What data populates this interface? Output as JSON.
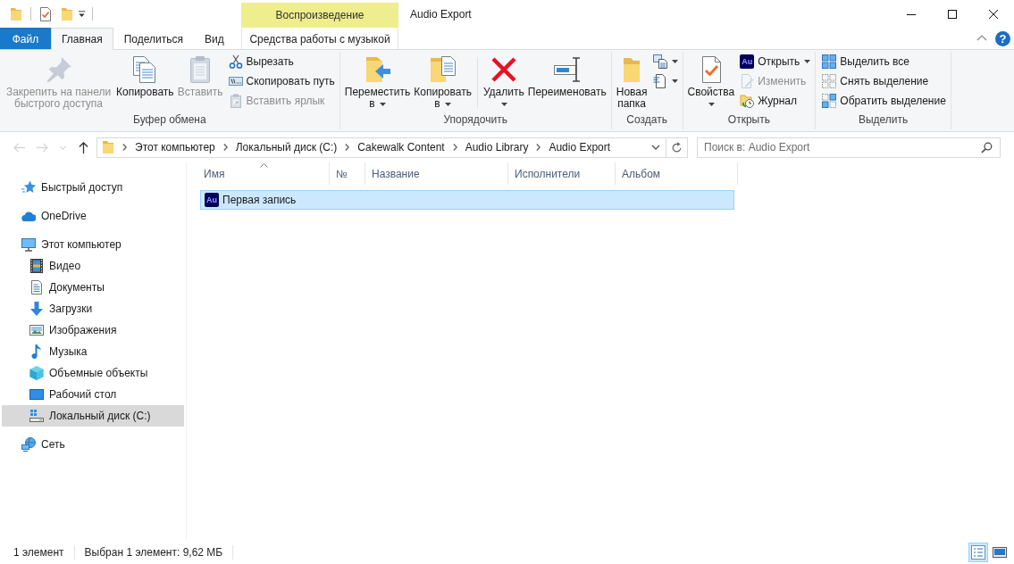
{
  "title_bar": {
    "title": "Audio Export",
    "context_tab_group": "Воспроизведение"
  },
  "ribbon_tabs": [
    {
      "label": "Файл",
      "kind": "file",
      "selected": false
    },
    {
      "label": "Главная",
      "kind": "tab",
      "selected": true
    },
    {
      "label": "Поделиться",
      "kind": "tab",
      "selected": false
    },
    {
      "label": "Вид",
      "kind": "tab",
      "selected": false
    },
    {
      "label": "Средства работы с музыкой",
      "kind": "context",
      "selected": false
    }
  ],
  "ribbon_help": "?",
  "ribbon": {
    "groups": [
      {
        "label": "Буфер обмена",
        "commands": [
          {
            "label": "Закрепить на панели быстрого доступа",
            "kind": "large",
            "disabled": true,
            "has_menu": false
          },
          {
            "label": "Копировать",
            "kind": "large",
            "disabled": false,
            "has_menu": false
          },
          {
            "label": "Вставить",
            "kind": "large",
            "disabled": true,
            "has_menu": false
          },
          {
            "label": "Вырезать",
            "kind": "small",
            "disabled": false,
            "has_menu": false
          },
          {
            "label": "Скопировать путь",
            "kind": "small",
            "disabled": false,
            "has_menu": false
          },
          {
            "label": "Вставить ярлык",
            "kind": "small",
            "disabled": true,
            "has_menu": false
          }
        ]
      },
      {
        "label": "Упорядочить",
        "commands": [
          {
            "label": "Переместить в",
            "kind": "large",
            "disabled": false,
            "has_menu": true
          },
          {
            "label": "Копировать в",
            "kind": "large",
            "disabled": false,
            "has_menu": true
          },
          {
            "label": "Удалить",
            "kind": "large",
            "disabled": false,
            "has_menu": true
          },
          {
            "label": "Переименовать",
            "kind": "large",
            "disabled": false,
            "has_menu": false
          }
        ]
      },
      {
        "label": "Создать",
        "commands": [
          {
            "label": "Новая папка",
            "kind": "large",
            "disabled": false,
            "has_menu": false
          },
          {
            "kind": "icon",
            "disabled": false,
            "has_menu": true
          },
          {
            "kind": "icon",
            "disabled": false,
            "has_menu": true
          }
        ]
      },
      {
        "label": "Открыть",
        "commands": [
          {
            "label": "Свойства",
            "kind": "large",
            "disabled": false,
            "has_menu": true
          },
          {
            "label": "Открыть",
            "kind": "small",
            "icon_text": "Au",
            "disabled": false,
            "has_menu": true
          },
          {
            "label": "Изменить",
            "kind": "small",
            "disabled": true,
            "has_menu": false
          },
          {
            "label": "Журнал",
            "kind": "small",
            "disabled": false,
            "has_menu": false
          }
        ]
      },
      {
        "label": "Выделить",
        "commands": [
          {
            "label": "Выделить все",
            "kind": "small",
            "disabled": false,
            "has_menu": false
          },
          {
            "label": "Снять выделение",
            "kind": "small",
            "disabled": false,
            "has_menu": false
          },
          {
            "label": "Обратить выделение",
            "kind": "small",
            "disabled": false,
            "has_menu": false
          }
        ]
      }
    ]
  },
  "navigation": {
    "buttons": [
      {
        "kind": "back",
        "disabled": true
      },
      {
        "kind": "forward",
        "disabled": true
      },
      {
        "kind": "recent",
        "disabled": true
      },
      {
        "kind": "up",
        "disabled": false
      }
    ]
  },
  "address_bar": {
    "breadcrumbs": [
      "Этот компьютер",
      "Локальный диск (C:)",
      "Cakewalk Content",
      "Audio Library",
      "Audio Export"
    ]
  },
  "search": {
    "placeholder": "Поиск в: Audio Export"
  },
  "sidebar": {
    "items": [
      {
        "label": "Быстрый доступ",
        "selected": false
      },
      {
        "label": "OneDrive",
        "selected": false
      },
      {
        "label": "Этот компьютер",
        "selected": false,
        "children": [
          {
            "label": "Видео",
            "selected": false
          },
          {
            "label": "Документы",
            "selected": false
          },
          {
            "label": "Загрузки",
            "selected": false
          },
          {
            "label": "Изображения",
            "selected": false
          },
          {
            "label": "Музыка",
            "selected": false
          },
          {
            "label": "Объемные объекты",
            "selected": false
          },
          {
            "label": "Рабочий стол",
            "selected": false
          },
          {
            "label": "Локальный диск (C:)",
            "selected": true
          }
        ]
      },
      {
        "label": "Сеть",
        "selected": false
      }
    ]
  },
  "file_list": {
    "columns": [
      {
        "label": "Имя",
        "sorted": true
      },
      {
        "label": "№",
        "sorted": false
      },
      {
        "label": "Название",
        "sorted": false
      },
      {
        "label": "Исполнители",
        "sorted": false
      },
      {
        "label": "Альбом",
        "sorted": false
      }
    ],
    "rows": [
      {
        "name": "Первая запись",
        "icon_text": "Au",
        "selected": true
      }
    ]
  },
  "status_bar": {
    "item_count": "1 элемент",
    "selection": "Выбран 1 элемент: 9,62 МБ",
    "view_buttons": [
      {
        "kind": "details",
        "selected": true
      },
      {
        "kind": "large_icons",
        "selected": false
      }
    ]
  }
}
